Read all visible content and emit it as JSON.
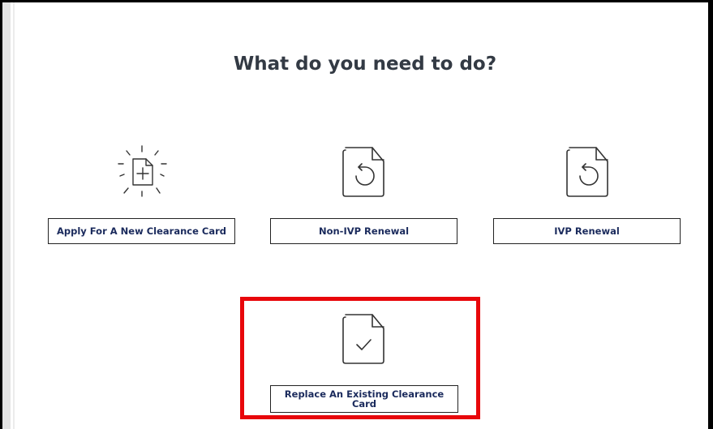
{
  "heading": "What do you need to do?",
  "options": [
    {
      "label": "Apply For A New Clearance Card",
      "icon": "document-plus-icon"
    },
    {
      "label": "Non-IVP Renewal",
      "icon": "document-renew-icon"
    },
    {
      "label": "IVP Renewal",
      "icon": "document-renew-icon"
    },
    {
      "label": "Replace An Existing Clearance Card",
      "icon": "document-check-icon"
    }
  ],
  "colors": {
    "button_text": "#1a2a5c",
    "highlight": "#e8070b",
    "heading": "#333a44"
  }
}
